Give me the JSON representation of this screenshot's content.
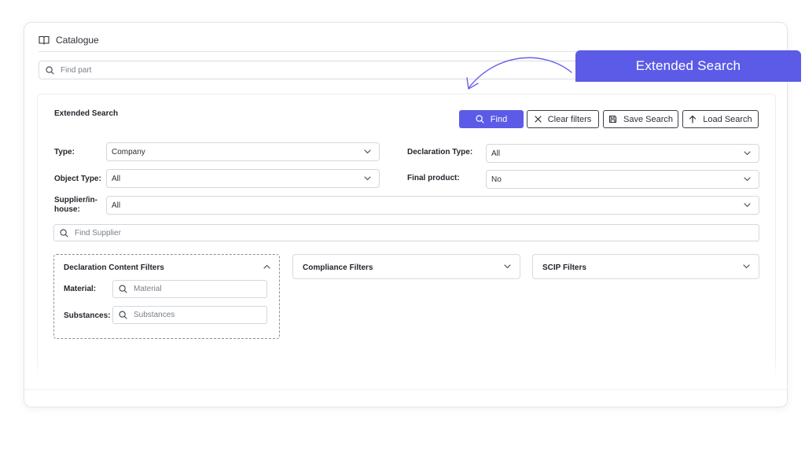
{
  "catalogue": {
    "title": "Catalogue",
    "find_part_placeholder": "Find part"
  },
  "callout": {
    "label": "Extended Search"
  },
  "extended_search": {
    "title": "Extended Search",
    "buttons": {
      "find": "Find",
      "clear_filters": "Clear filters",
      "save_search": "Save Search",
      "load_search": "Load Search"
    },
    "fields": {
      "type": {
        "label": "Type:",
        "value": "Company"
      },
      "object_type": {
        "label": "Object Type:",
        "value": "All"
      },
      "supplier_inhouse": {
        "label": "Supplier/in-house:",
        "value": "All"
      },
      "declaration_type": {
        "label": "Declaration Type:",
        "value": "All"
      },
      "final_product": {
        "label": "Final product:",
        "value": "No"
      }
    },
    "find_supplier_placeholder": "Find Supplier",
    "filters": {
      "declaration_content": {
        "title": "Declaration Content Filters",
        "material_label": "Material:",
        "material_placeholder": "Material",
        "substances_label": "Substances:",
        "substances_placeholder": "Substances"
      },
      "compliance": {
        "title": "Compliance Filters"
      },
      "scip": {
        "title": "SCIP Filters"
      }
    }
  },
  "colors": {
    "accent": "#5b5be8",
    "border": "#d4d7dd",
    "text": "#2b2f36"
  },
  "icons": [
    "book-icon",
    "search-icon",
    "close-icon",
    "save-icon",
    "arrow-up-icon",
    "chevron-down-icon",
    "chevron-up-icon",
    "curved-arrow-icon"
  ]
}
